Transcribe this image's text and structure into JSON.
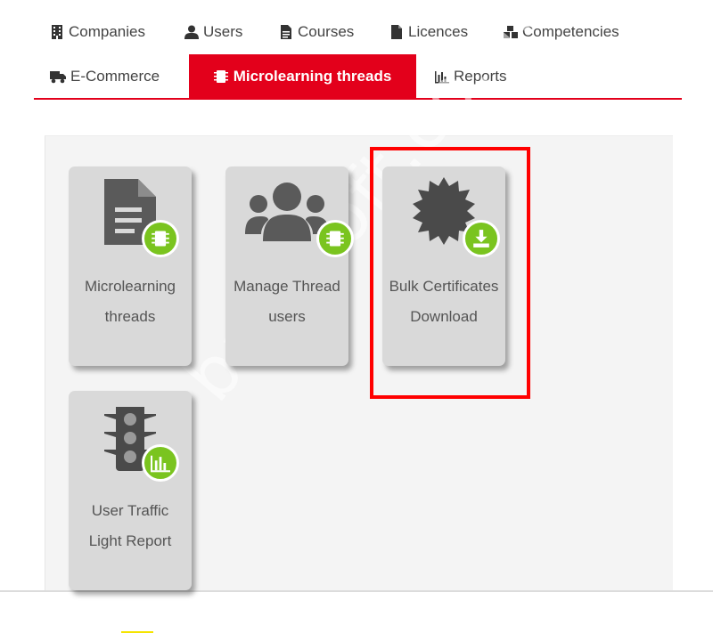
{
  "nav": {
    "row1": [
      {
        "label": "Companies",
        "icon": "building-icon"
      },
      {
        "label": "Users",
        "icon": "user-icon"
      },
      {
        "label": "Courses",
        "icon": "file-icon"
      },
      {
        "label": "Licences",
        "icon": "document-icon"
      },
      {
        "label": "Competencies",
        "icon": "cubes-icon"
      }
    ],
    "row2": [
      {
        "label": "E-Commerce",
        "icon": "truck-icon"
      },
      {
        "label": "Microlearning threads",
        "icon": "chip-icon",
        "active": true
      },
      {
        "label": "Reports",
        "icon": "bar-chart-icon"
      }
    ]
  },
  "tiles": [
    {
      "line1": "Microlearning",
      "line2": "threads",
      "icon": "file-text-icon",
      "badge": "chip-badge-icon"
    },
    {
      "line1": "Manage Thread",
      "line2": "users",
      "icon": "users-icon",
      "badge": "chip-badge-icon"
    },
    {
      "line1": "Bulk Certificates",
      "line2": "Download",
      "icon": "certificate-icon",
      "badge": "download-badge-icon"
    },
    {
      "line1": "User Traffic",
      "line2": "Light Report",
      "icon": "traffic-light-icon",
      "badge": "chart-badge-icon"
    }
  ],
  "watermark": "barasoft.co.uk",
  "colors": {
    "accent": "#e3001b",
    "badge": "#7ac41f",
    "highlight": "#ff0000",
    "tile": "#d9d9d9"
  }
}
